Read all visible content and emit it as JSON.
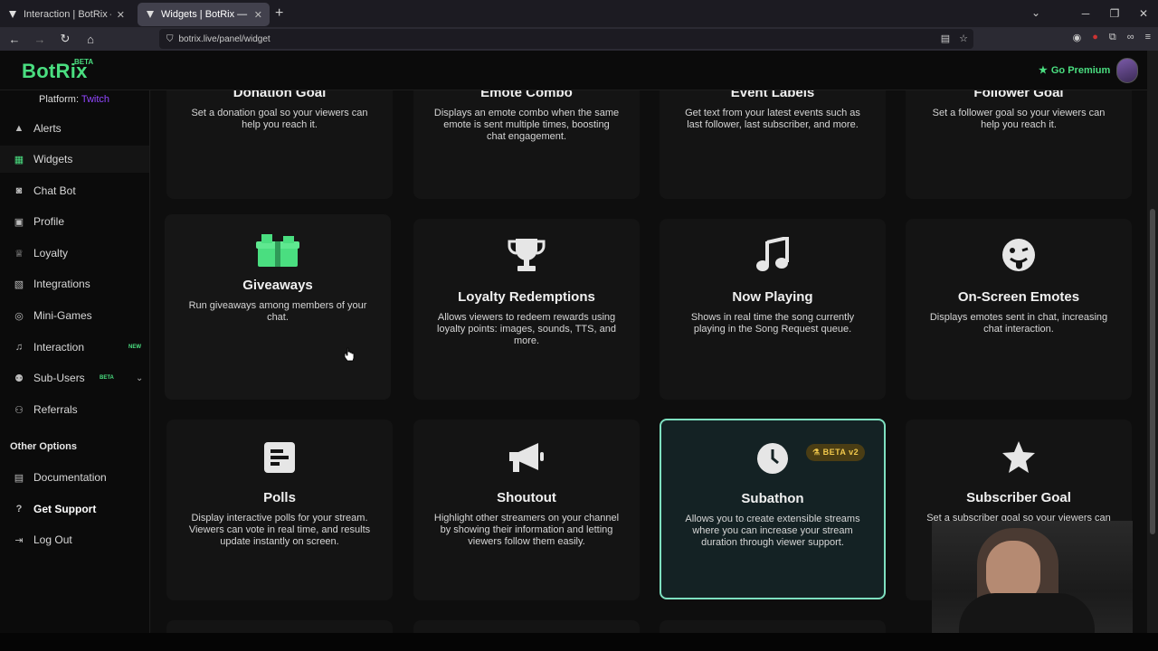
{
  "browser": {
    "tabs": [
      {
        "title": "Interaction | BotRix — Cloud Stre",
        "active": false
      },
      {
        "title": "Widgets | BotRix — Cloud Strea",
        "active": true
      }
    ],
    "url": "botrix.live/panel/widget"
  },
  "header": {
    "logo": "BotRix",
    "logo_badge": "BETA",
    "premium_label": "Go Premium"
  },
  "sidebar": {
    "platform_label": "Platform:",
    "platform_value": "Twitch",
    "items": [
      {
        "label": "Alerts",
        "icon": "warning-icon"
      },
      {
        "label": "Widgets",
        "icon": "grid-icon",
        "active": true
      },
      {
        "label": "Chat Bot",
        "icon": "robot-icon"
      },
      {
        "label": "Profile",
        "icon": "id-card-icon"
      },
      {
        "label": "Loyalty",
        "icon": "trophy-icon"
      },
      {
        "label": "Integrations",
        "icon": "puzzle-icon"
      },
      {
        "label": "Mini-Games",
        "icon": "gamepad-icon"
      },
      {
        "label": "Interaction",
        "icon": "music-icon",
        "badge": "NEW"
      },
      {
        "label": "Sub-Users",
        "icon": "users-icon",
        "badge": "BETA"
      },
      {
        "label": "Referrals",
        "icon": "user-plus-icon"
      }
    ],
    "other_title": "Other Options",
    "other_items": [
      {
        "label": "Documentation",
        "icon": "book-icon"
      },
      {
        "label": "Get Support",
        "icon": "question-icon"
      },
      {
        "label": "Log Out",
        "icon": "logout-icon"
      }
    ]
  },
  "widgets": {
    "row1": [
      {
        "title": "Donation Goal",
        "desc": "Set a donation goal so your viewers can help you reach it."
      },
      {
        "title": "Emote Combo",
        "desc": "Displays an emote combo when the same emote is sent multiple times, boosting chat engagement."
      },
      {
        "title": "Event Labels",
        "desc": "Get text from your latest events such as last follower, last subscriber, and more."
      },
      {
        "title": "Follower Goal",
        "desc": "Set a follower goal so your viewers can help you reach it."
      }
    ],
    "row2": [
      {
        "title": "Giveaways",
        "desc": "Run giveaways among members of your chat.",
        "icon": "gift-icon"
      },
      {
        "title": "Loyalty Redemptions",
        "desc": "Allows viewers to redeem rewards using loyalty points: images, sounds, TTS, and more.",
        "icon": "trophy-icon"
      },
      {
        "title": "Now Playing",
        "desc": "Shows in real time the song currently playing in the Song Request queue.",
        "icon": "music-note-icon"
      },
      {
        "title": "On-Screen Emotes",
        "desc": "Displays emotes sent in chat, increasing chat interaction.",
        "icon": "emoji-icon"
      }
    ],
    "row3": [
      {
        "title": "Polls",
        "desc": "Display interactive polls for your stream. Viewers can vote in real time, and results update instantly on screen.",
        "icon": "poll-icon"
      },
      {
        "title": "Shoutout",
        "desc": "Highlight other streamers on your channel by showing their information and letting viewers follow them easily.",
        "icon": "megaphone-icon"
      },
      {
        "title": "Subathon",
        "desc": "Allows you to create extensible streams where you can increase your stream duration through viewer support.",
        "icon": "clock-icon",
        "badge": "BETA v2"
      },
      {
        "title": "Subscriber Goal",
        "desc": "Set a subscriber goal so your viewers can",
        "icon": "star-icon"
      }
    ]
  },
  "colors": {
    "accent": "#4ade80",
    "twitch": "#9146ff",
    "highlight_border": "#7ee0c0",
    "beta_badge": "#f2c94c"
  }
}
